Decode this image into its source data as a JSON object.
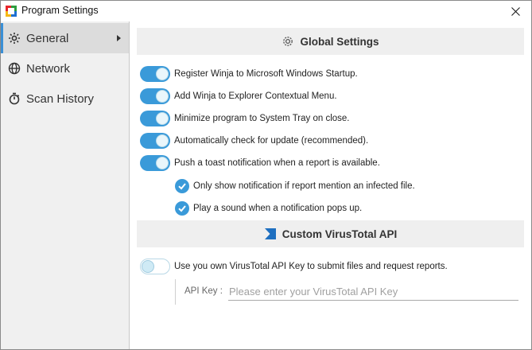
{
  "window": {
    "title": "Program Settings",
    "icon": "winja-logo-icon",
    "close_icon": "close-icon"
  },
  "sidebar": {
    "items": [
      {
        "label": "General",
        "icon": "gear-icon",
        "active": true
      },
      {
        "label": "Network",
        "icon": "globe-icon",
        "active": false
      },
      {
        "label": "Scan History",
        "icon": "stopwatch-icon",
        "active": false
      }
    ]
  },
  "global_settings": {
    "title": "Global Settings",
    "icon": "gear-icon",
    "toggles": [
      {
        "label": "Register Winja to Microsoft Windows Startup.",
        "on": true
      },
      {
        "label": "Add Winja to Explorer Contextual Menu.",
        "on": true
      },
      {
        "label": "Minimize program to System Tray on close.",
        "on": true
      },
      {
        "label": "Automatically check for update (recommended).",
        "on": true
      },
      {
        "label": "Push a toast notification when a report is available.",
        "on": true
      }
    ],
    "checks": [
      {
        "label": "Only show notification if report mention an infected file.",
        "checked": true
      },
      {
        "label": "Play a sound when a notification pops up.",
        "checked": true
      }
    ]
  },
  "virustotal": {
    "title": "Custom VirusTotal API",
    "icon": "virustotal-icon",
    "toggle_label": "Use you own VirusTotal API Key to submit files and request reports.",
    "toggle_on": false,
    "api_key_label": "API Key :",
    "api_key_value": "",
    "api_key_placeholder": "Please enter your VirusTotal API Key"
  },
  "colors": {
    "accent": "#3a9ad9",
    "sidebar_bg": "#f0f0f0",
    "header_bg": "#efefef",
    "virustotal_blue": "#1e6fc0"
  }
}
